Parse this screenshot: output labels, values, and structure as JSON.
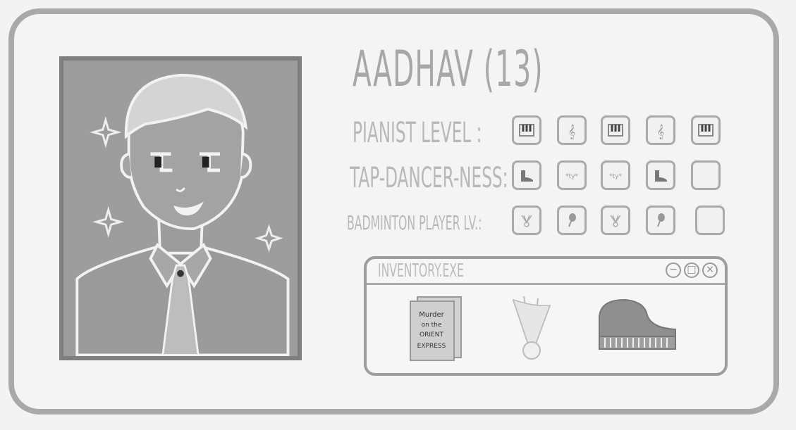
{
  "profile": {
    "name": "AADHAV (13)"
  },
  "stats": [
    {
      "label": "PIANIST LEVEL :",
      "slots": [
        "piano-keys-icon",
        "treble-clef-icon",
        "piano-keys-icon",
        "treble-clef-icon",
        "piano-keys-icon"
      ]
    },
    {
      "label": "TAP-DANCER-NESS:",
      "slots": [
        "tap-shoe-icon",
        "tap-sound-icon",
        "tap-sound-icon",
        "tap-shoe-icon",
        "empty"
      ]
    },
    {
      "label": "BADMINTON PLAYER LV.:",
      "slots": [
        "shuttlecock-icon",
        "racket-icon",
        "shuttlecock-icon",
        "racket-icon",
        "empty"
      ]
    }
  ],
  "inventory": {
    "title": "INVENTORY.EXE",
    "window_controls": [
      "minimize-icon",
      "maximize-icon",
      "close-icon"
    ],
    "items": [
      {
        "name": "book-icon",
        "text": "Murder on the ORIENT EXPRESS"
      },
      {
        "name": "shuttlecock-icon"
      },
      {
        "name": "grand-piano-icon"
      }
    ]
  },
  "colors": {
    "frame": "#a9a9a9",
    "portrait_bg": "#9d9d9d",
    "text": "#b8b8b8"
  }
}
